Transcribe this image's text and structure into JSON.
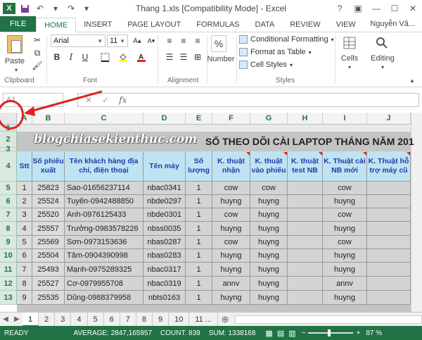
{
  "window": {
    "title": "Thang 1.xls  [Compatibility Mode] - Excel",
    "logo_text": "X",
    "controls": [
      "?",
      "▣",
      "—",
      "☐",
      "✕"
    ]
  },
  "qat": {
    "save": "save-icon",
    "undo": "undo-icon",
    "redo": "redo-icon"
  },
  "tabs": [
    "FILE",
    "HOME",
    "INSERT",
    "PAGE LAYOUT",
    "FORMULAS",
    "DATA",
    "REVIEW",
    "VIEW"
  ],
  "active_tab": "HOME",
  "user": "Nguyễn Vă...",
  "ribbon": {
    "clipboard": {
      "paste_label": "Paste",
      "group": "Clipboard"
    },
    "font": {
      "name": "Arial",
      "size": "11",
      "group": "Font",
      "bold": "B",
      "italic": "I",
      "underline": "U"
    },
    "alignment": {
      "group": "Alignment"
    },
    "number": {
      "label": "Number",
      "percent": "%"
    },
    "styles": {
      "conditional": "Conditional Formatting",
      "format_table": "Format as Table",
      "cell_styles": "Cell Styles",
      "group": "Styles"
    },
    "cells": {
      "label": "Cells"
    },
    "editing": {
      "label": "Editing"
    }
  },
  "formula_bar": {
    "name_box": "A1",
    "cancel": "✕",
    "enter": "✓",
    "fx": "fx",
    "value": ""
  },
  "columns": [
    "A",
    "B",
    "C",
    "D",
    "E",
    "F",
    "G",
    "H",
    "I",
    "J"
  ],
  "row_numbers": [
    "1",
    "2",
    "3",
    "4",
    "5",
    "6",
    "7",
    "8",
    "9",
    "10",
    "11",
    "12",
    "13"
  ],
  "sheet": {
    "title": "SỐ THEO DÕI CÀI LAPTOP THÁNG  NĂM 201",
    "watermark": "blogchiasekienthuc.com",
    "headers": [
      "Stt",
      "Số phiếu xuất",
      "Tên khách hàng địa chỉ, điện thoại",
      "Tên máy",
      "Số lượng",
      "K. thuật nhận",
      "K. thuật vào phiếu",
      "K. thuật test NB",
      "K. Thuật cài NB mới",
      "K. Thuật hỗ trợ máy cũ"
    ],
    "rows": [
      [
        "1",
        "25823",
        "Sao-01656237114",
        "nbac0341",
        "1",
        "cow",
        "cow",
        "",
        "cow",
        ""
      ],
      [
        "2",
        "25524",
        "Tuyên-0942488850",
        "nbde0297",
        "1",
        "huyng",
        "huyng",
        "",
        "huyng",
        ""
      ],
      [
        "3",
        "25520",
        "Anh-0976125433",
        "nbde0301",
        "1",
        "cow",
        "huyng",
        "",
        "cow",
        ""
      ],
      [
        "4",
        "25557",
        "Trưởng-0983578226",
        "nbss0035",
        "1",
        "huyng",
        "huyng",
        "",
        "huyng",
        ""
      ],
      [
        "5",
        "25569",
        "Sơn-0973153636",
        "nbas0287",
        "1",
        "cow",
        "huyng",
        "",
        "cow",
        ""
      ],
      [
        "6",
        "25504",
        "Tâm-0904390998",
        "nbas0283",
        "1",
        "huyng",
        "huyng",
        "",
        "huyng",
        ""
      ],
      [
        "7",
        "25493",
        "Mạnh-0975289325",
        "nbac0317",
        "1",
        "huyng",
        "huyng",
        "",
        "huyng",
        ""
      ],
      [
        "8",
        "25527",
        "Cơ-0979955708",
        "nbac0319",
        "1",
        "annv",
        "huyng",
        "",
        "annv",
        ""
      ],
      [
        "9",
        "25535",
        "Dũng-0988379958",
        "nbts0163",
        "1",
        "huyng",
        "huyng",
        "",
        "huyng",
        ""
      ]
    ]
  },
  "sheet_tabs": [
    "1",
    "2",
    "3",
    "4",
    "5",
    "6",
    "7",
    "8",
    "9",
    "10",
    "11 ..."
  ],
  "active_sheet": "1",
  "status": {
    "ready": "READY",
    "average": "AVERAGE: 2847,165957",
    "count": "COUNT: 839",
    "sum": "SUM: 1338168",
    "zoom": "87 %"
  }
}
